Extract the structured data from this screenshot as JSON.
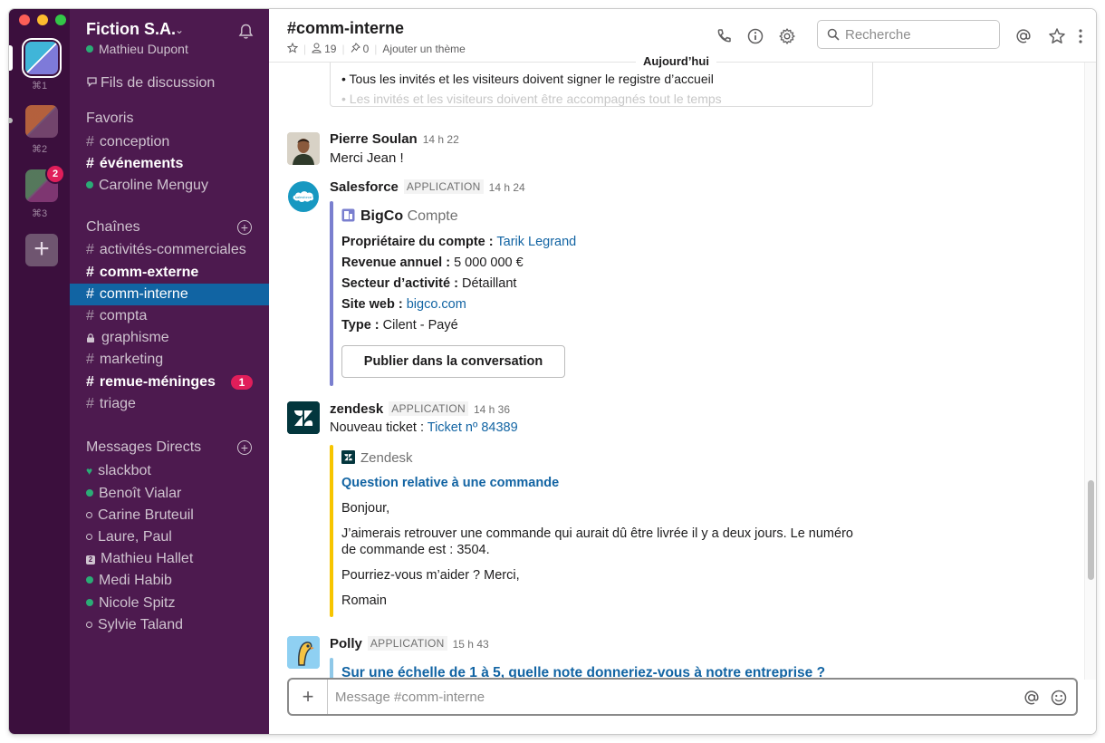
{
  "teams": {
    "items": [
      {
        "shortcut": "⌘1"
      },
      {
        "shortcut": "⌘2"
      },
      {
        "shortcut": "⌘3",
        "badge": "2"
      }
    ],
    "add_symbol": "+"
  },
  "sidebar": {
    "workspace_name": "Fiction S.A.",
    "chevron": "⌄",
    "user_name": "Mathieu Dupont",
    "threads_label": "Fils de discussion",
    "favorites": {
      "title": "Favoris",
      "items": [
        {
          "prefix": "#",
          "label": "conception"
        },
        {
          "prefix": "#",
          "label": "événements"
        },
        {
          "label": "Caroline Menguy"
        }
      ]
    },
    "channels": {
      "title": "Chaînes",
      "add_symbol": "+",
      "items": [
        {
          "prefix": "#",
          "label": "activités-commerciales"
        },
        {
          "prefix": "#",
          "label": "comm-externe"
        },
        {
          "prefix": "#",
          "label": "comm-interne"
        },
        {
          "prefix": "#",
          "label": "compta"
        },
        {
          "label": "graphisme"
        },
        {
          "prefix": "#",
          "label": "marketing"
        },
        {
          "prefix": "#",
          "label": "remue-méninges",
          "badge": "1"
        },
        {
          "prefix": "#",
          "label": "triage"
        }
      ]
    },
    "dms": {
      "title": "Messages Directs",
      "add_symbol": "+",
      "items": [
        {
          "label": "slackbot",
          "heart": "♥"
        },
        {
          "label": "Benoît Vialar"
        },
        {
          "label": "Carine Bruteuil"
        },
        {
          "label": "Laure, Paul"
        },
        {
          "label": "Mathieu Hallet",
          "group_count": "2"
        },
        {
          "label": "Medi Habib"
        },
        {
          "label": "Nicole Spitz"
        },
        {
          "label": "Sylvie Taland"
        }
      ]
    }
  },
  "header": {
    "channel_title": "#comm-interne",
    "members_count": "19",
    "pins_count": "0",
    "add_topic": "Ajouter un thème",
    "search_placeholder": "Recherche",
    "day_divider": "Aujourd’hui"
  },
  "messages": {
    "prev_card": {
      "line1": "• Tous les invités et les visiteurs doivent signer le registre d’accueil",
      "line2": "• Les invités et les visiteurs doivent être accompagnés tout le temps"
    },
    "pierre": {
      "name": "Pierre Soulan",
      "time": "14 h 22",
      "text": "Merci Jean !"
    },
    "salesforce": {
      "name": "Salesforce",
      "app_tag": "APPLICATION",
      "time": "14 h 24",
      "card_title": "BigCo",
      "card_type": "Compte",
      "fields": [
        {
          "label": "Propriétaire du compte :",
          "value": "Tarik Legrand"
        },
        {
          "label": "Revenue annuel :",
          "value": "5 000 000 €"
        },
        {
          "label": "Secteur d’activité :",
          "value": "Détaillant"
        },
        {
          "label": "Site web :",
          "value": "bigco.com"
        },
        {
          "label": "Type :",
          "value": "Cilent - Payé"
        }
      ],
      "button": "Publier dans la conversation"
    },
    "zendesk": {
      "name": "zendesk",
      "app_tag": "APPLICATION",
      "time": "14 h 36",
      "text_prefix": "Nouveau ticket :",
      "ticket_link": "Ticket nº 84389",
      "card_source": "Zendesk",
      "card_title": "Question relative à une commande",
      "body": [
        "Bonjour,",
        "J’aimerais retrouver une commande qui aurait dû être livrée il y a deux jours. Le numéro",
        "de commande est : 3504.",
        "Pourriez-vous m’aider ? Merci,",
        "Romain"
      ]
    },
    "polly": {
      "name": "Polly",
      "app_tag": "APPLICATION",
      "time": "15 h 43",
      "question": "Sur une échelle de 1 à 5, quelle note donneriez-vous à notre entreprise ?"
    }
  },
  "composer": {
    "placeholder": "Message #comm-interne",
    "plus": "+"
  },
  "colors": {
    "team_bar": "#3b0f3d",
    "sidebar": "#4d1a4f",
    "active_channel": "#1164a3",
    "badge": "#e01e5a",
    "presence": "#2bac76",
    "link": "#1264a3",
    "salesforce_attach": "#7a7fcf",
    "zendesk_attach": "#f7c500",
    "polly_attach": "#8fc8e8"
  }
}
